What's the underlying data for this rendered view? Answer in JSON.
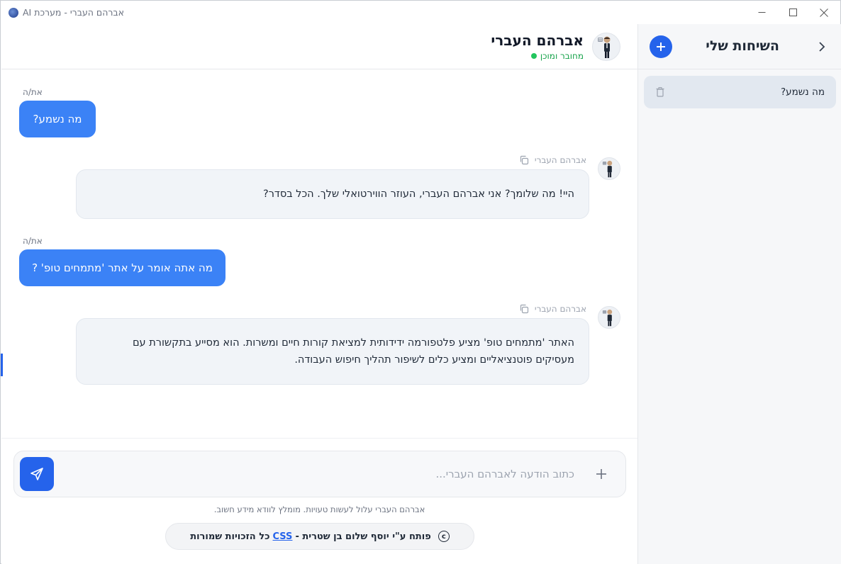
{
  "window": {
    "title": "אברהם העברי - מערכת AI"
  },
  "sidebar": {
    "title": "השיחות שלי",
    "chats": [
      {
        "label": "מה נשמע?"
      }
    ]
  },
  "header": {
    "bot_name": "אברהם העברי",
    "status": "מחובר ומוכן",
    "status_color": "#22c55e"
  },
  "messages": [
    {
      "role": "user",
      "sender": "את/ה",
      "text": "מה נשמע?"
    },
    {
      "role": "bot",
      "sender": "אברהם העברי",
      "text": "היי! מה שלומך? אני אברהם העברי, העוזר הווירטואלי שלך. הכל בסדר?"
    },
    {
      "role": "user",
      "sender": "את/ה",
      "text": "מה אתה אומר על אתר 'מתמחים טופ' ?"
    },
    {
      "role": "bot",
      "sender": "אברהם העברי",
      "text": "האתר 'מתמחים טופ' מציע פלטפורמה ידידותית למציאת קורות חיים ומשרות. הוא מסייע בתקשורת עם מעסיקים פוטנציאליים ומציע כלים לשיפור תהליך חיפוש העבודה."
    }
  ],
  "composer": {
    "placeholder": "כתוב הודעה לאברהם העברי...",
    "value": ""
  },
  "footer": {
    "disclaimer": "אברהם העברי עלול לעשות טעויות. מומלץ לוודא מידע חשוב.",
    "credit_prefix": "פותח ע\"י יוסף שלום בן שטרית -",
    "credit_link": "CSS",
    "credit_suffix": "כל הזכויות שמורות"
  },
  "colors": {
    "accent": "#2563eb",
    "user_bubble": "#3b82f6",
    "bot_bubble": "#f1f4f8"
  }
}
